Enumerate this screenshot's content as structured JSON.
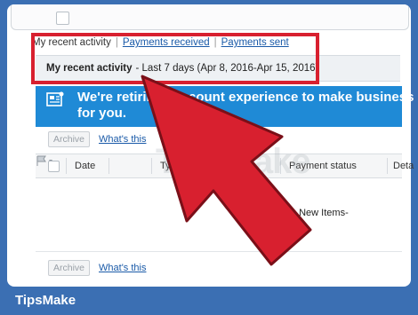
{
  "tabs": {
    "recent_activity": "My recent activity",
    "payments_received": "Payments received",
    "payments_sent": "Payments sent"
  },
  "subheader": {
    "title": "My recent activity",
    "range": "- Last 7 days (Apr 8, 2016-Apr 15, 2016)"
  },
  "banner": {
    "line1": "We're retiring ... ccount experience to make business ea",
    "line2": "for you."
  },
  "toolbar": {
    "archive_label": "Archive",
    "whats_this_label": "What's this"
  },
  "table": {
    "columns": [
      "Date",
      "Type",
      "Payment status",
      "Deta"
    ],
    "empty_message": "No New Items-"
  },
  "watermark": "TipsMake",
  "footer": {
    "brand": "TipsMake"
  },
  "colors": {
    "accent_red": "#d8202f",
    "banner_blue": "#1f8ad6",
    "frame_blue": "#3b6fb3",
    "link_blue": "#1a5aa8"
  }
}
